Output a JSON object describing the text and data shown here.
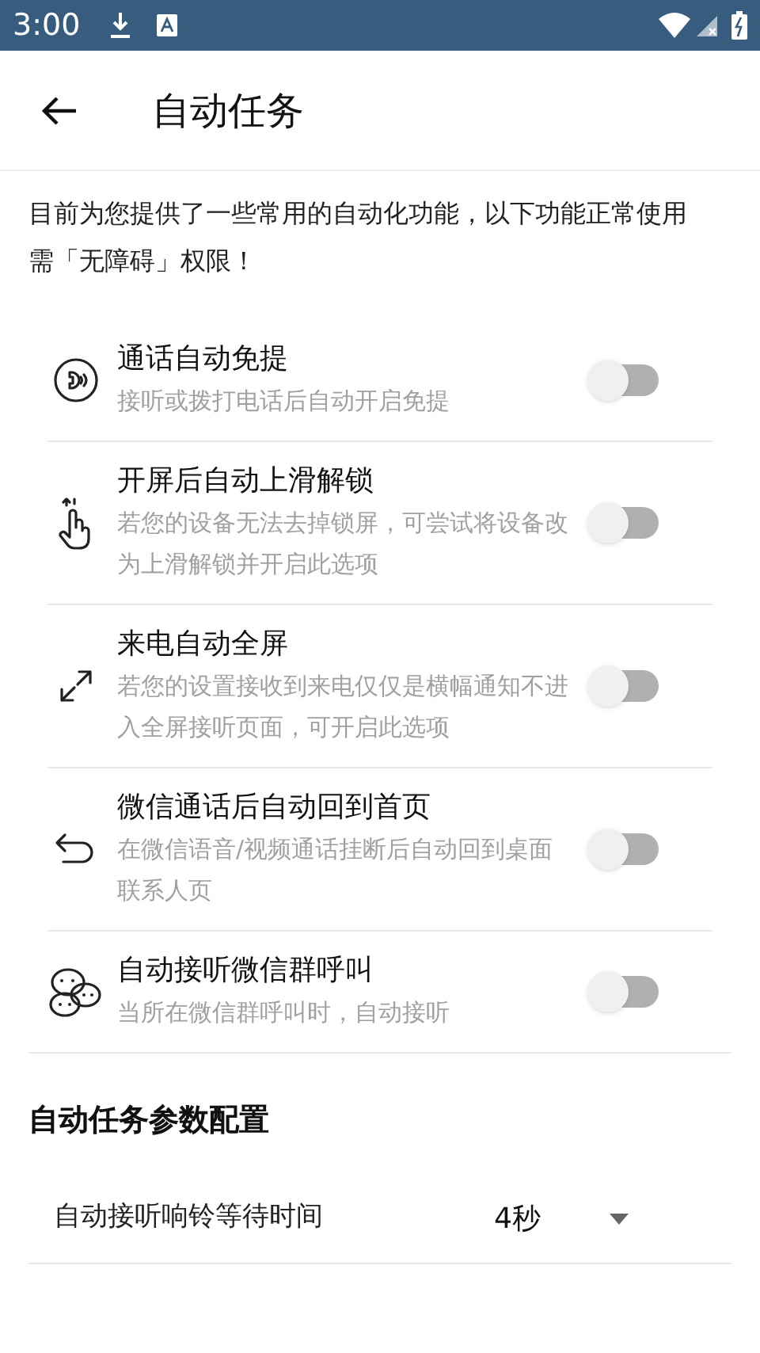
{
  "status_bar": {
    "time": "3:00"
  },
  "app_bar": {
    "title": "自动任务"
  },
  "intro": "目前为您提供了一些常用的自动化功能，以下功能正常使用需「无障碍」权限！",
  "tasks": [
    {
      "kind": "speaker",
      "title": "通话自动免提",
      "subtitle": "接听或拨打电话后自动开启免提",
      "on": false
    },
    {
      "kind": "swipe",
      "title": "开屏后自动上滑解锁",
      "subtitle": "若您的设备无法去掉锁屏，可尝试将设备改为上滑解锁并开启此选项",
      "on": false
    },
    {
      "kind": "expand",
      "title": "来电自动全屏",
      "subtitle": "若您的设置接收到来电仅仅是横幅通知不进入全屏接听页面，可开启此选项",
      "on": false
    },
    {
      "kind": "back",
      "title": "微信通话后自动回到首页",
      "subtitle": "在微信语音/视频通话挂断后自动回到桌面联系人页",
      "on": false
    },
    {
      "kind": "chat",
      "title": "自动接听微信群呼叫",
      "subtitle": "当所在微信群呼叫时，自动接听",
      "on": false
    }
  ],
  "config": {
    "heading": "自动任务参数配置",
    "settings": [
      {
        "label": "自动接听响铃等待时间",
        "value": "4秒"
      }
    ]
  }
}
